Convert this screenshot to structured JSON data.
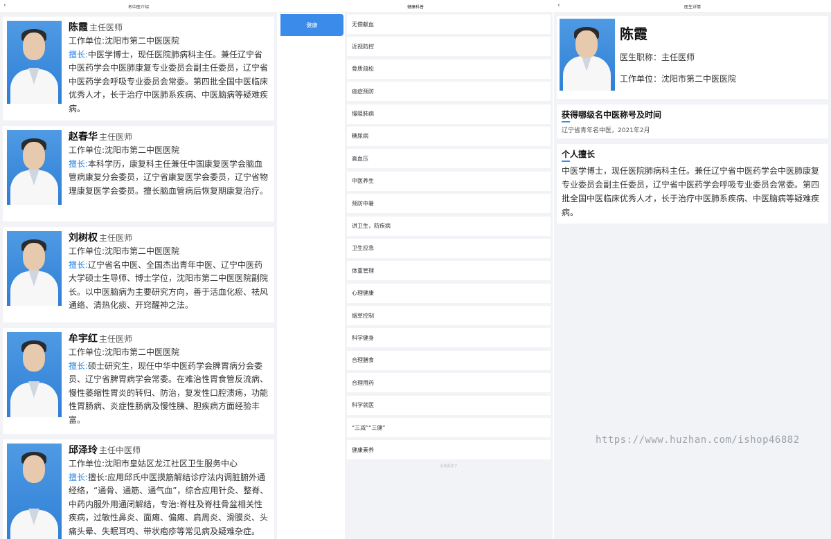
{
  "screen1": {
    "title": "名中医介绍",
    "back_icon": "chevron-left-icon",
    "unit_prefix": "工作单位:",
    "spec_prefix": "擅长:",
    "doctors": [
      {
        "name": "陈霞",
        "title": "主任医师",
        "unit": "沈阳市第二中医医院",
        "spec": "中医学博士，现任医院肺病科主任。兼任辽宁省中医药学会中医肺康复专业委员会副主任委员，辽宁省中医药学会呼吸专业委员会常委。第四批全国中医临床优秀人才，长于治疗中医肺系疾病、中医脑病等疑难疾病。"
      },
      {
        "name": "赵春华",
        "title": "主任医师",
        "unit": "沈阳市第二中医医院",
        "spec": "本科学历，康复科主任兼任中国康复医学会脑血管病康复分会委员，辽宁省康复医学会委员，辽宁省物理康复医学会委员。擅长脑血管病后恢复期康复治疗。"
      },
      {
        "name": "刘树权",
        "title": "主任医师",
        "unit": "沈阳市第二中医医院",
        "spec": "辽宁省名中医、全国杰出青年中医、辽宁中医药大学硕士生导师、博士学位，沈阳市第二中医医院副院长。以中医脑病为主要研究方向，善于活血化瘀、祛风通络、清热化痰、开窍醒神之法。"
      },
      {
        "name": "牟宇红",
        "title": "主任医师",
        "unit": "沈阳市第二中医医院",
        "spec": "硕士研究生，现任中华中医药学会脾胃病分会委员、辽宁省脾胃病学会常委。在难治性胃食管反流病、慢性萎缩性胃炎的转归、防治，复发性口腔溃疡，功能性胃肠病、炎症性肠病及慢性胰、胆疾病方面经验丰富。"
      },
      {
        "name": "邱泽玲",
        "title": "主任中医师",
        "unit": "沈阳市皇姑区龙江社区卫生服务中心",
        "spec": "擅长:应用邱氏中医摸筋解结诊疗法内调脏腑外通经络，“通骨、通筋、通气血”，综合应用针灸、整脊、中药内服外用通闭解结，专治:脊柱及脊柱骨盆相关性疾病，过敏性鼻炎、面瘫、偏瘫、肩周炎、滑膜炎、头痛头晕、失眠耳鸣、带状疱疹等常见病及疑难杂症。"
      }
    ]
  },
  "screen2": {
    "title": "健康科普",
    "active_category": "健康",
    "items": [
      "无偿献血",
      "近视防控",
      "骨质疏松",
      "癌症预防",
      "慢阻肺病",
      "糖尿病",
      "高血压",
      "中医养生",
      "预防中暑",
      "讲卫生，防疾病",
      "卫生应急",
      "体重管理",
      "心理健康",
      "烟草控制",
      "科学健身",
      "合理膳食",
      "合理用药",
      "科学就医",
      "“三减”“三健”",
      "健康素养"
    ],
    "end_text": "没有更多了"
  },
  "screen3": {
    "title": "医生详情",
    "name": "陈霞",
    "title_row": "医生职称：主任医师",
    "unit_row": "工作单位：沈阳市第二中医医院",
    "honor_heading": "获得哪级名中医称号及时间",
    "honor_value": "辽宁省青年名中医，2021年2月",
    "spec_heading": "个人擅长",
    "spec_body": "中医学博士，现任医院肺病科主任。兼任辽宁省中医药学会中医肺康复专业委员会副主任委员，辽宁省中医药学会呼吸专业委员会常委。第四批全国中医临床优秀人才，长于治疗中医肺系疾病、中医脑病等疑难疾病。"
  },
  "watermark": "https://www.huzhan.com/ishop46882"
}
